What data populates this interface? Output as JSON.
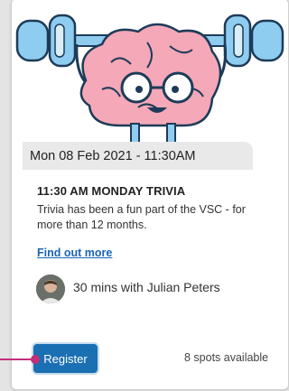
{
  "event": {
    "date_label": "Mon 08 Feb 2021 - 11:30AM",
    "title": "11:30 AM MONDAY TRIVIA",
    "description": "Trivia has been a fun part of the VSC - for more than 12 months.",
    "link_label": "Find out more",
    "host_text": "30 mins with Julian Peters",
    "register_label": "Register",
    "spots_text": "8 spots available"
  },
  "hero_image": {
    "icon": "brain-lifting-dumbbell-icon"
  },
  "colors": {
    "accent": "#1b6fb3",
    "link": "#1a64b5",
    "pointer": "#c2307b",
    "brain": "#f2a4b3",
    "dumbbell": "#7fc1e8"
  }
}
